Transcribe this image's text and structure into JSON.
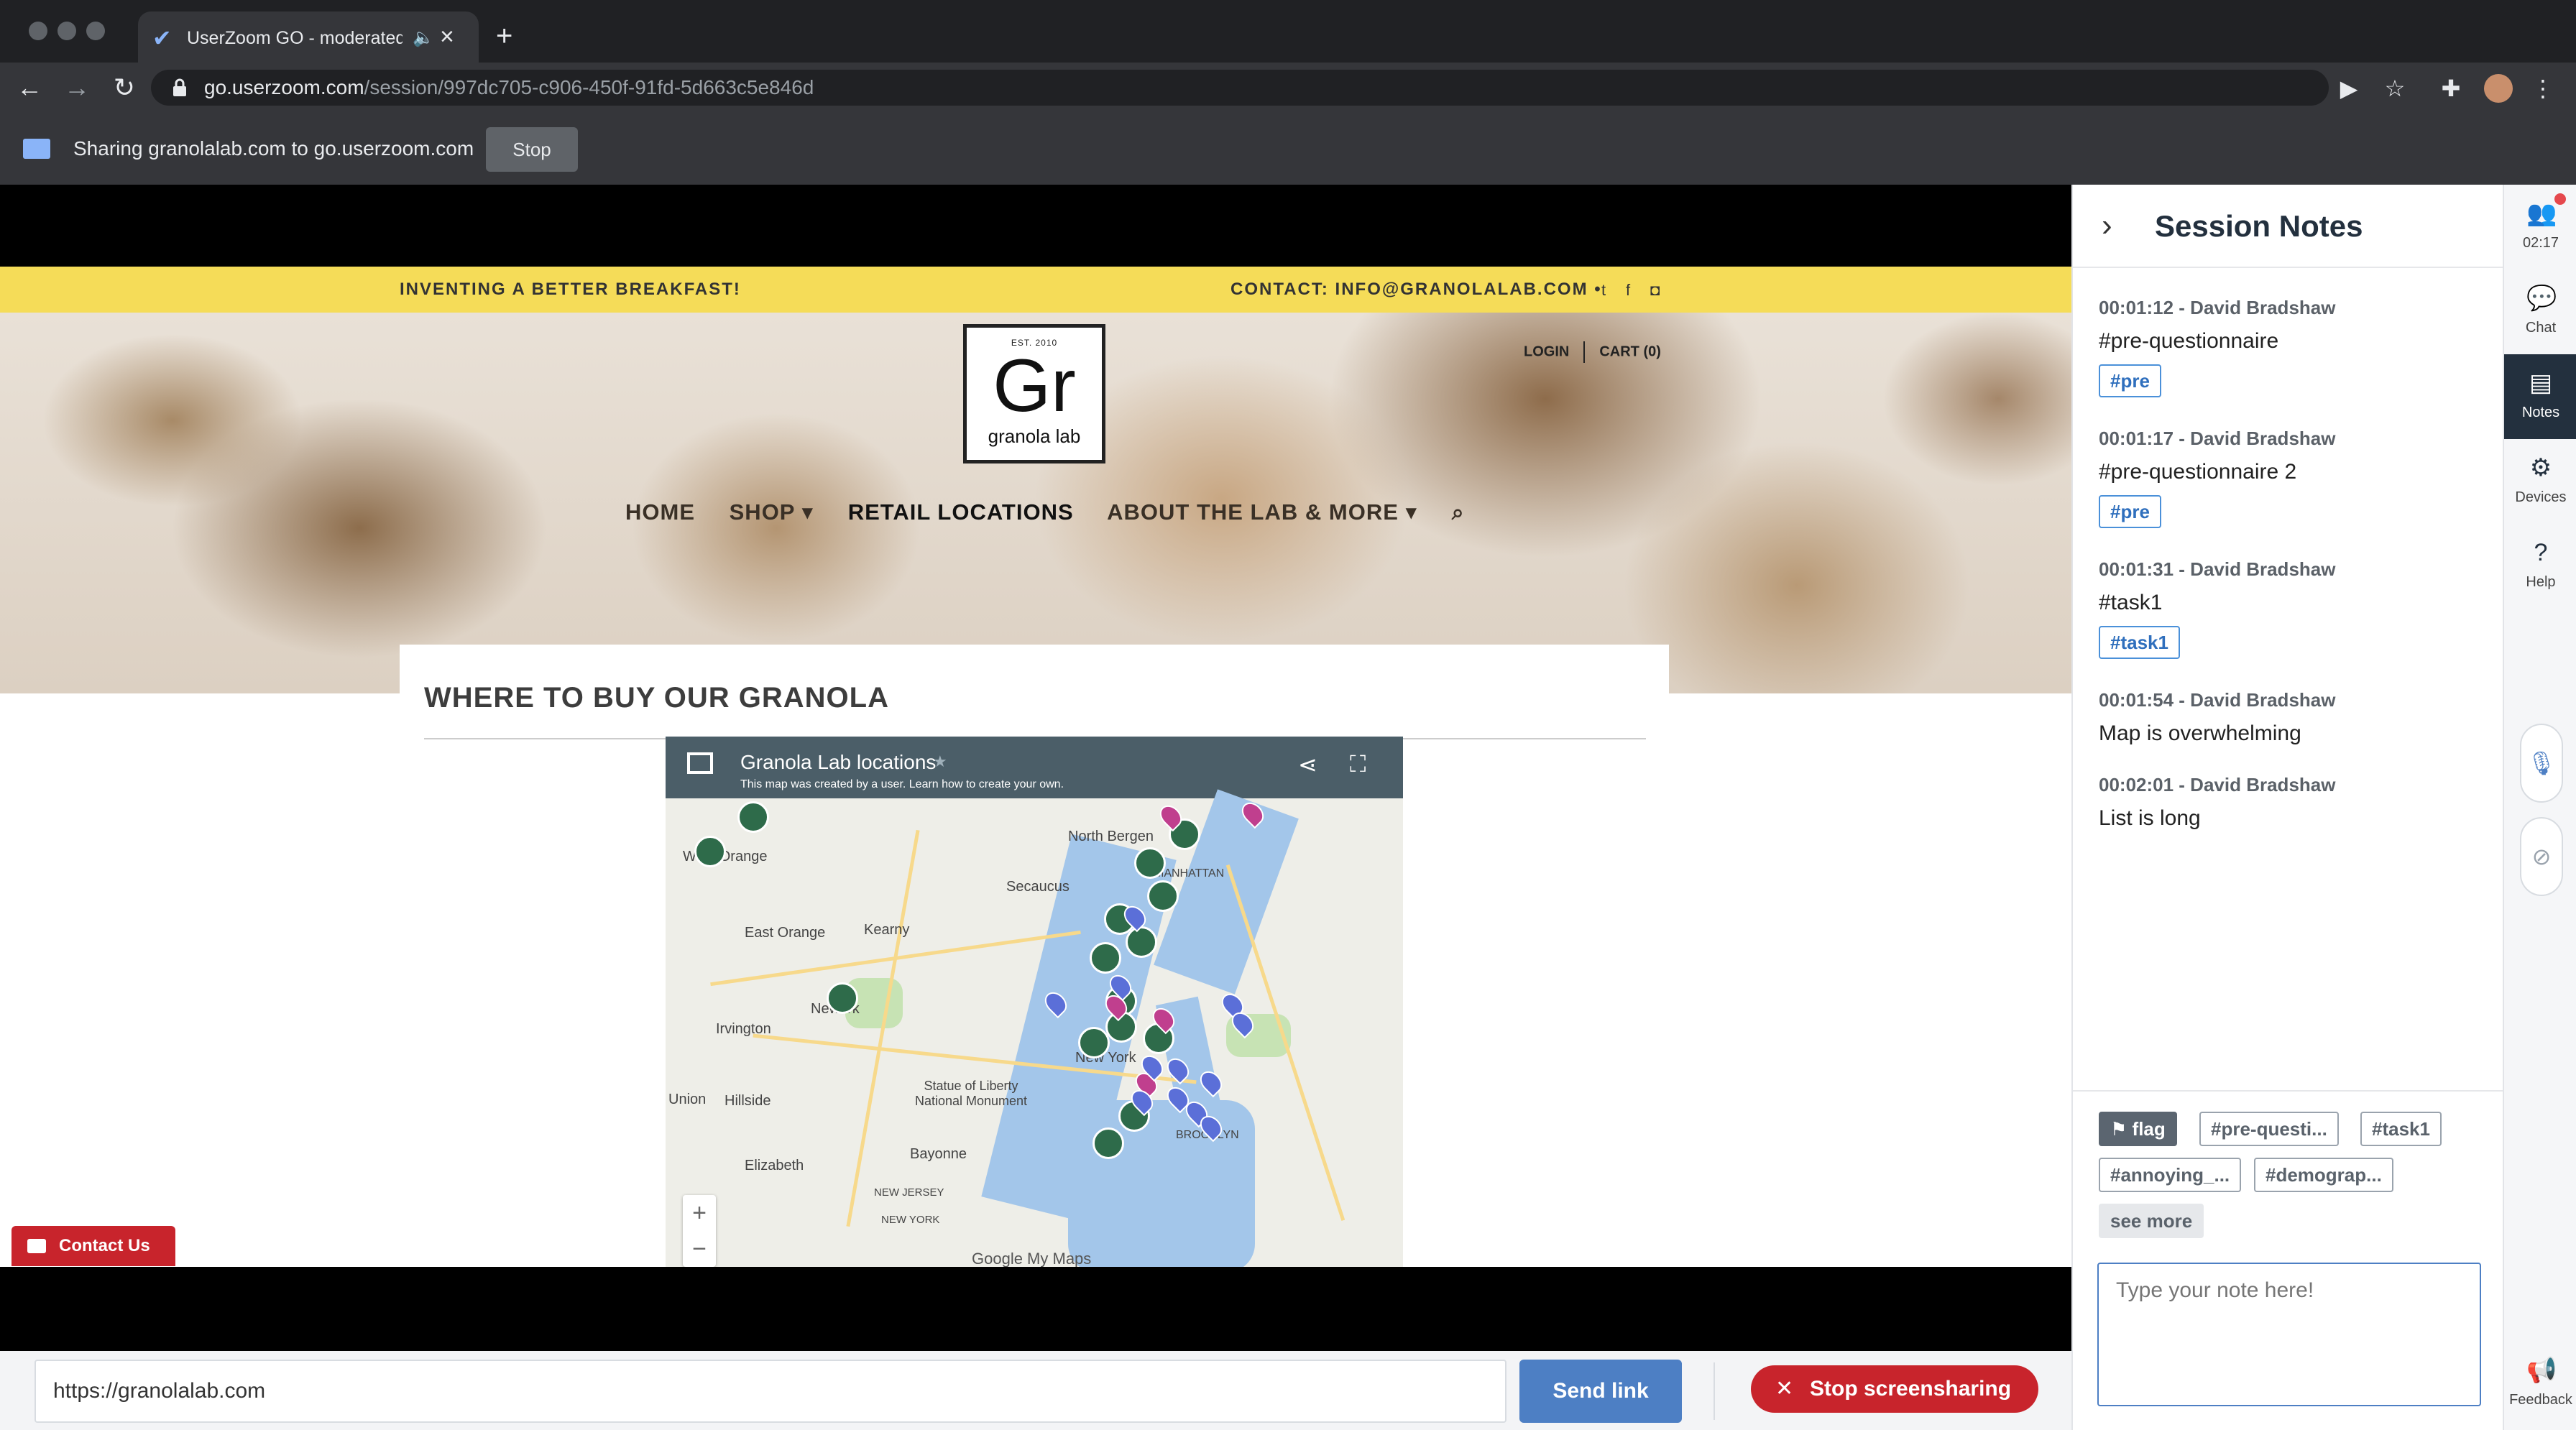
{
  "browser": {
    "tab_title": "UserZoom GO - moderated",
    "url_host": "go.userzoom.com",
    "url_path": "/session/997dc705-c906-450f-91fd-5d663c5e846d",
    "share_text": "Sharing granolalab.com to go.userzoom.com",
    "share_stop_label": "Stop"
  },
  "site": {
    "tagline": "INVENTING A BETTER BREAKFAST!",
    "contact": "CONTACT:   INFO@GRANOLALAB.COM  •",
    "logo_est": "EST. 2010",
    "logo_mark": "Gr",
    "logo_name": "granola lab",
    "login": "LOGIN",
    "cart": "CART (0)",
    "nav": [
      "HOME",
      "SHOP ▾",
      "RETAIL LOCATIONS",
      "ABOUT THE LAB & MORE ▾"
    ],
    "heading": "WHERE TO BUY OUR GRANOLA",
    "map_title": "Granola Lab locations",
    "map_subtitle": "This map was created by a user. Learn how to create your own.",
    "map_labels": [
      "West Orange",
      "North Bergen",
      "Secaucus",
      "East Orange",
      "Kearny",
      "Newark",
      "Irvington",
      "Union",
      "Hillside",
      "Statue of Liberty National Monument",
      "Elizabeth",
      "Bayonne",
      "NEW JERSEY",
      "NEW YORK",
      "New York",
      "BROOKLYN",
      "MANHATTAN"
    ],
    "map_attribution": "Google My Maps",
    "contact_us": "Contact Us"
  },
  "bottom": {
    "link_value": "https://granolalab.com",
    "send_link": "Send link",
    "stop_screensharing": "Stop screensharing"
  },
  "notes": {
    "title": "Session Notes",
    "items": [
      {
        "meta": "00:01:12 - David Bradshaw",
        "text": "#pre-questionnaire",
        "tag": "#pre"
      },
      {
        "meta": "00:01:17 - David Bradshaw",
        "text": "#pre-questionnaire 2",
        "tag": "#pre"
      },
      {
        "meta": "00:01:31 - David Bradshaw",
        "text": "#task1",
        "tag": "#task1"
      },
      {
        "meta": "00:01:54 - David Bradshaw",
        "text": "Map is overwhelming"
      },
      {
        "meta": "00:02:01 - David Bradshaw",
        "text": "List is long"
      }
    ],
    "chips": [
      "flag",
      "#pre-questi...",
      "#task1",
      "#annoying_...",
      "#demograp..."
    ],
    "see_more": "see more",
    "placeholder": "Type your note here!"
  },
  "rail": {
    "timer": "02:17",
    "items": [
      "Chat",
      "Notes",
      "Devices",
      "Help",
      "Feedback"
    ]
  },
  "colors": {
    "accent": "#4d7fc4",
    "danger": "#c8242c",
    "rail_active": "#23303e",
    "site_topbar": "#f5dc58"
  }
}
